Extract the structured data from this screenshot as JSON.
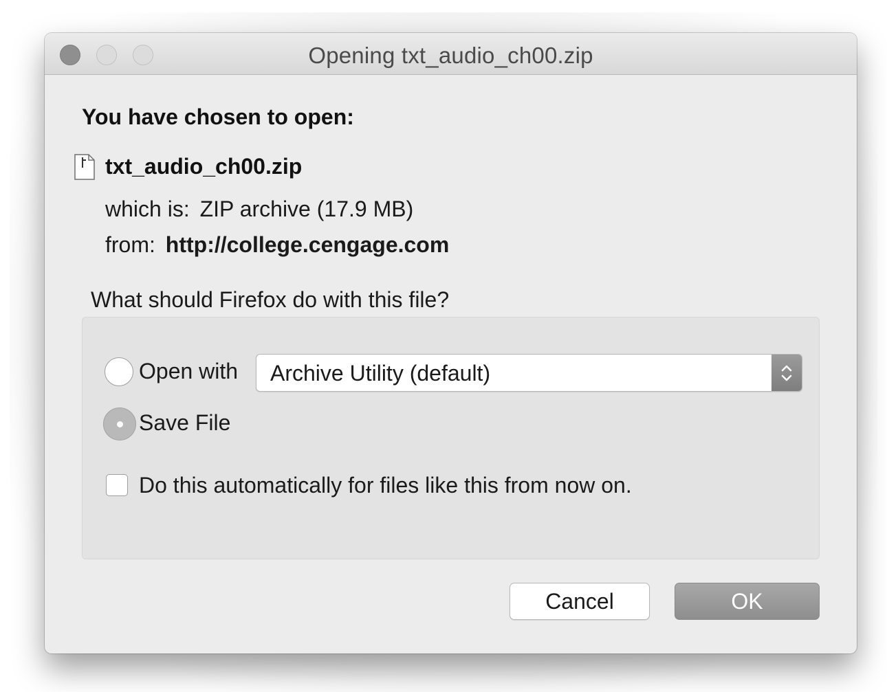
{
  "window": {
    "title": "Opening txt_audio_ch00.zip"
  },
  "dialog": {
    "heading": "You have chosen to open:",
    "file_icon": "document-icon",
    "filename": "txt_audio_ch00.zip",
    "type_label": "which is:",
    "type_value": "ZIP archive (17.9 MB)",
    "source_label": "from:",
    "source_value": "http://college.cengage.com",
    "question": "What should Firefox do with this file?"
  },
  "options": {
    "open_with_label": "Open with",
    "open_with_app": "Archive Utility (default)",
    "save_file_label": "Save File",
    "selected": "save_file",
    "auto_label": "Do this automatically for files like this from now on.",
    "auto_checked": false
  },
  "buttons": {
    "cancel": "Cancel",
    "ok": "OK"
  }
}
